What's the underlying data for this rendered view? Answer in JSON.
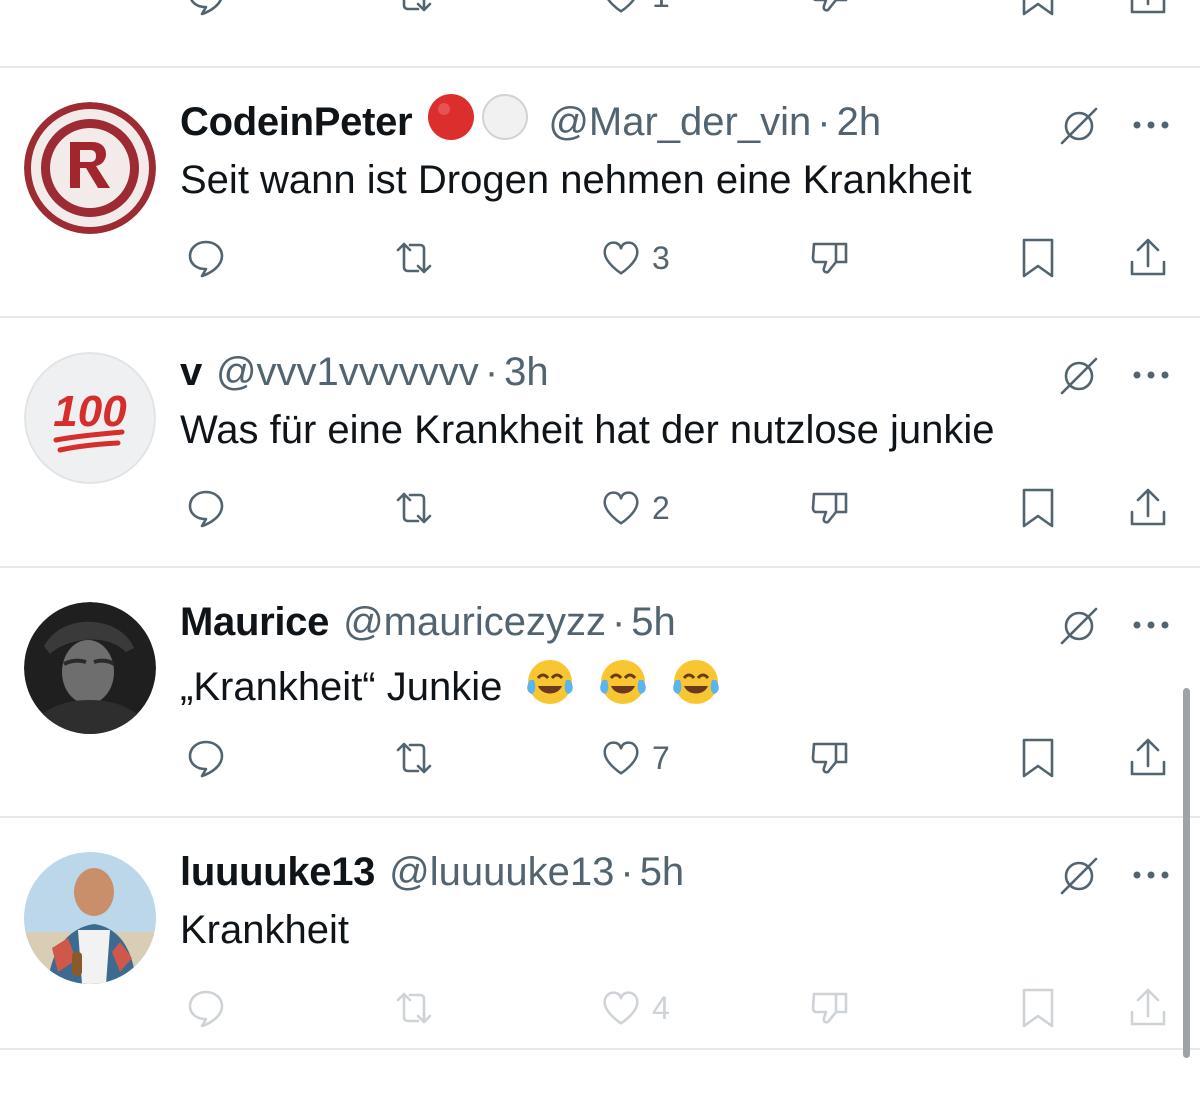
{
  "top_partial": {
    "like_count": "1"
  },
  "replies": [
    {
      "display_name": "CodeinPeter",
      "badges": [
        "red-circle-emoji",
        "white-circle-emoji"
      ],
      "handle": "@Mar_der_vin",
      "separator": "·",
      "time": "2h",
      "text": "Seit wann ist Drogen nehmen eine Krankheit",
      "like_count": "3",
      "avatar": "rwe-logo-avatar"
    },
    {
      "display_name": "v",
      "handle": "@vvv1vvvvvvv",
      "separator": "·",
      "time": "3h",
      "text": "Was für eine Krankheit hat der nutzlose junkie",
      "like_count": "2",
      "avatar": "hundred-points-emoji-avatar",
      "avatar_text": "100"
    },
    {
      "display_name": "Maurice",
      "handle": "@mauricezyzz",
      "separator": "·",
      "time": "5h",
      "text": "„Krankheit“ Junkie",
      "text_emojis": [
        "face-with-tears-of-joy",
        "face-with-tears-of-joy",
        "face-with-tears-of-joy"
      ],
      "like_count": "7",
      "avatar": "person-photo-avatar"
    },
    {
      "display_name": "luuuuke13",
      "handle": "@luuuuke13",
      "separator": "·",
      "time": "5h",
      "text": "Krankheit",
      "like_count": "4",
      "avatar": "person-photo-avatar"
    }
  ],
  "colors": {
    "text": "#0f1419",
    "secondary": "#536471",
    "divider": "#e6e9ec"
  }
}
